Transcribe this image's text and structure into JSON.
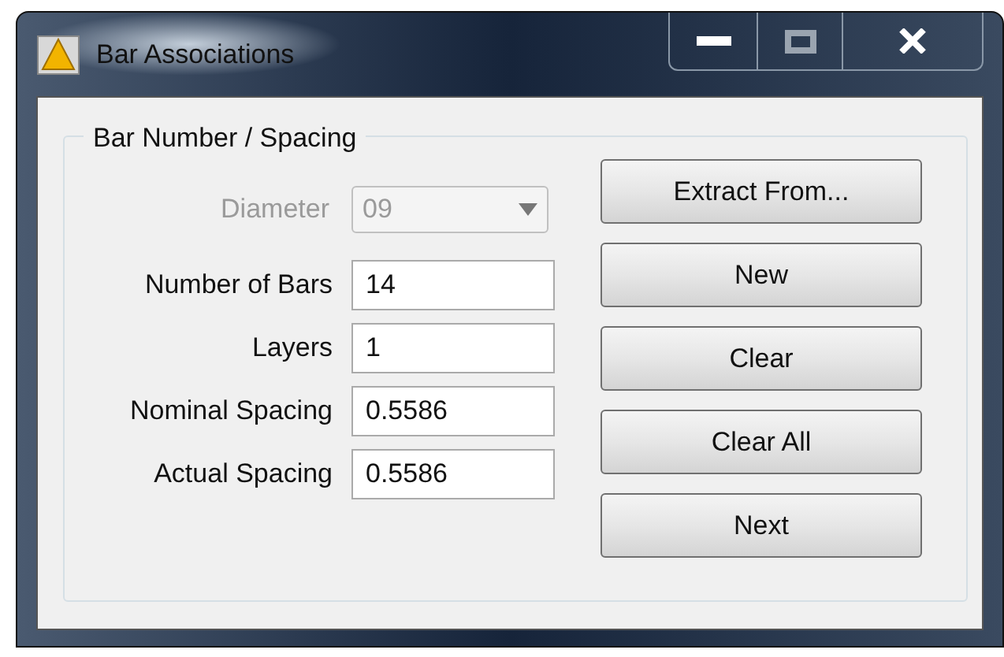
{
  "window": {
    "title": "Bar Associations"
  },
  "group": {
    "title": "Bar Number / Spacing"
  },
  "diameter": {
    "label": "Diameter",
    "value": "09",
    "disabled": true
  },
  "fields": [
    {
      "label": "Number of Bars",
      "value": "14"
    },
    {
      "label": "Layers",
      "value": "1"
    },
    {
      "label": "Nominal Spacing",
      "value": "0.5586"
    },
    {
      "label": "Actual Spacing",
      "value": "0.5586"
    }
  ],
  "buttons": [
    "Extract From...",
    "New",
    "Clear",
    "Clear All",
    "Next"
  ]
}
